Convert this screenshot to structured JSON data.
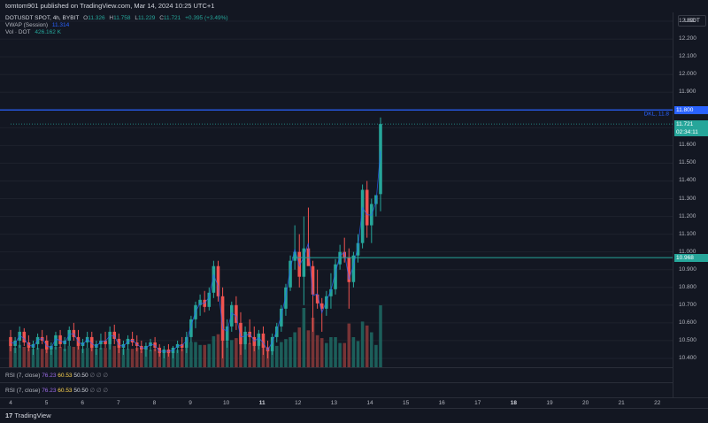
{
  "header": {
    "publisher_text": "tomtom901 published on TradingView.com, Mar 14, 2024 10:25 UTC+1"
  },
  "legend": {
    "symbol": "DOTUSDT SPOT, 4h, BYBIT",
    "open_label": "O",
    "open": "11.326",
    "high_label": "H",
    "high": "11.758",
    "low_label": "L",
    "low": "11.229",
    "close_label": "C",
    "close": "11.721",
    "change": "+0.395 (+3.49%)",
    "vwap_label": "VWAP (Session)",
    "vwap_value": "11.314",
    "vol_label": "Vol · DOT",
    "vol_value": "426.162 K"
  },
  "price_axis": {
    "currency": "USDT",
    "ticks": [
      "12.300",
      "12.200",
      "12.100",
      "12.000",
      "11.900",
      "11.800",
      "11.700",
      "11.600",
      "11.500",
      "11.400",
      "11.300",
      "11.200",
      "11.100",
      "11.000",
      "10.900",
      "10.800",
      "10.700",
      "10.600",
      "10.500",
      "10.400"
    ],
    "level_label": "11.800",
    "price_label": "11.721",
    "countdown": "02:34:11",
    "support_label": "10.968"
  },
  "chart": {
    "level_line_text": "DKL, 11.8"
  },
  "rsi_panes": [
    {
      "name": "RSI (7, close)",
      "v1": "76.23",
      "v2": "60.53",
      "v3": "50.50",
      "extra": "∅ ∅ ∅"
    },
    {
      "name": "RSI (7, close)",
      "v1": "76.23",
      "v2": "60.53",
      "v3": "50.50",
      "extra": "∅ ∅ ∅"
    }
  ],
  "time_axis": {
    "labels": [
      "4",
      "5",
      "6",
      "7",
      "8",
      "9",
      "10",
      "11",
      "12",
      "13",
      "14",
      "15",
      "16",
      "17",
      "18",
      "19",
      "20",
      "21",
      "22"
    ]
  },
  "footer": {
    "brand": "TradingView",
    "logo_mark": "17"
  },
  "colors": {
    "bg": "#131722",
    "up": "#26a69a",
    "down": "#ef5350",
    "level_line": "#2962ff",
    "support_line": "#26a69a",
    "vwap": "#2962ff",
    "vol_up": "#1f6b64",
    "vol_down": "#8a3a3a"
  },
  "chart_data": {
    "type": "candlestick",
    "symbol": "DOTUSDT SPOT",
    "interval": "4h",
    "ylim": [
      10.35,
      12.35
    ],
    "candles": [
      {
        "o": 10.52,
        "h": 10.56,
        "l": 10.44,
        "c": 10.47
      },
      {
        "o": 10.47,
        "h": 10.52,
        "l": 10.43,
        "c": 10.5
      },
      {
        "o": 10.5,
        "h": 10.58,
        "l": 10.46,
        "c": 10.55
      },
      {
        "o": 10.55,
        "h": 10.57,
        "l": 10.47,
        "c": 10.49
      },
      {
        "o": 10.49,
        "h": 10.53,
        "l": 10.44,
        "c": 10.46
      },
      {
        "o": 10.46,
        "h": 10.5,
        "l": 10.42,
        "c": 10.48
      },
      {
        "o": 10.48,
        "h": 10.54,
        "l": 10.45,
        "c": 10.52
      },
      {
        "o": 10.52,
        "h": 10.56,
        "l": 10.48,
        "c": 10.5
      },
      {
        "o": 10.5,
        "h": 10.53,
        "l": 10.43,
        "c": 10.45
      },
      {
        "o": 10.45,
        "h": 10.49,
        "l": 10.42,
        "c": 10.47
      },
      {
        "o": 10.47,
        "h": 10.55,
        "l": 10.45,
        "c": 10.53
      },
      {
        "o": 10.53,
        "h": 10.56,
        "l": 10.46,
        "c": 10.48
      },
      {
        "o": 10.48,
        "h": 10.52,
        "l": 10.44,
        "c": 10.5
      },
      {
        "o": 10.5,
        "h": 10.58,
        "l": 10.47,
        "c": 10.56
      },
      {
        "o": 10.56,
        "h": 10.6,
        "l": 10.5,
        "c": 10.52
      },
      {
        "o": 10.52,
        "h": 10.56,
        "l": 10.45,
        "c": 10.47
      },
      {
        "o": 10.47,
        "h": 10.51,
        "l": 10.43,
        "c": 10.49
      },
      {
        "o": 10.49,
        "h": 10.55,
        "l": 10.46,
        "c": 10.52
      },
      {
        "o": 10.52,
        "h": 10.55,
        "l": 10.44,
        "c": 10.46
      },
      {
        "o": 10.46,
        "h": 10.5,
        "l": 10.42,
        "c": 10.48
      },
      {
        "o": 10.48,
        "h": 10.54,
        "l": 10.45,
        "c": 10.5
      },
      {
        "o": 10.5,
        "h": 10.55,
        "l": 10.46,
        "c": 10.48
      },
      {
        "o": 10.48,
        "h": 10.58,
        "l": 10.45,
        "c": 10.55
      },
      {
        "o": 10.55,
        "h": 10.59,
        "l": 10.48,
        "c": 10.51
      },
      {
        "o": 10.51,
        "h": 10.54,
        "l": 10.43,
        "c": 10.46
      },
      {
        "o": 10.46,
        "h": 10.5,
        "l": 10.42,
        "c": 10.48
      },
      {
        "o": 10.48,
        "h": 10.53,
        "l": 10.45,
        "c": 10.51
      },
      {
        "o": 10.51,
        "h": 10.55,
        "l": 10.47,
        "c": 10.49
      },
      {
        "o": 10.49,
        "h": 10.53,
        "l": 10.44,
        "c": 10.47
      },
      {
        "o": 10.47,
        "h": 10.5,
        "l": 10.43,
        "c": 10.45
      },
      {
        "o": 10.45,
        "h": 10.49,
        "l": 10.41,
        "c": 10.47
      },
      {
        "o": 10.47,
        "h": 10.51,
        "l": 10.44,
        "c": 10.49
      },
      {
        "o": 10.49,
        "h": 10.52,
        "l": 10.44,
        "c": 10.46
      },
      {
        "o": 10.46,
        "h": 10.48,
        "l": 10.41,
        "c": 10.43
      },
      {
        "o": 10.43,
        "h": 10.47,
        "l": 10.4,
        "c": 10.45
      },
      {
        "o": 10.45,
        "h": 10.48,
        "l": 10.41,
        "c": 10.43
      },
      {
        "o": 10.43,
        "h": 10.47,
        "l": 10.4,
        "c": 10.46
      },
      {
        "o": 10.46,
        "h": 10.5,
        "l": 10.43,
        "c": 10.48
      },
      {
        "o": 10.48,
        "h": 10.52,
        "l": 10.44,
        "c": 10.46
      },
      {
        "o": 10.46,
        "h": 10.55,
        "l": 10.43,
        "c": 10.52
      },
      {
        "o": 10.52,
        "h": 10.64,
        "l": 10.49,
        "c": 10.62
      },
      {
        "o": 10.62,
        "h": 10.72,
        "l": 10.57,
        "c": 10.7
      },
      {
        "o": 10.7,
        "h": 10.76,
        "l": 10.64,
        "c": 10.73
      },
      {
        "o": 10.73,
        "h": 10.78,
        "l": 10.66,
        "c": 10.69
      },
      {
        "o": 10.69,
        "h": 10.8,
        "l": 10.67,
        "c": 10.77
      },
      {
        "o": 10.77,
        "h": 10.95,
        "l": 10.74,
        "c": 10.92
      },
      {
        "o": 10.92,
        "h": 10.95,
        "l": 10.72,
        "c": 10.75
      },
      {
        "o": 10.75,
        "h": 10.8,
        "l": 10.4,
        "c": 10.5
      },
      {
        "o": 10.5,
        "h": 10.62,
        "l": 10.46,
        "c": 10.58
      },
      {
        "o": 10.58,
        "h": 10.72,
        "l": 10.55,
        "c": 10.7
      },
      {
        "o": 10.7,
        "h": 10.75,
        "l": 10.56,
        "c": 10.6
      },
      {
        "o": 10.6,
        "h": 10.66,
        "l": 10.42,
        "c": 10.48
      },
      {
        "o": 10.48,
        "h": 10.58,
        "l": 10.45,
        "c": 10.55
      },
      {
        "o": 10.55,
        "h": 10.62,
        "l": 10.48,
        "c": 10.52
      },
      {
        "o": 10.52,
        "h": 10.58,
        "l": 10.44,
        "c": 10.47
      },
      {
        "o": 10.47,
        "h": 10.56,
        "l": 10.45,
        "c": 10.54
      },
      {
        "o": 10.54,
        "h": 10.58,
        "l": 10.42,
        "c": 10.46
      },
      {
        "o": 10.46,
        "h": 10.5,
        "l": 10.4,
        "c": 10.44
      },
      {
        "o": 10.44,
        "h": 10.54,
        "l": 10.42,
        "c": 10.52
      },
      {
        "o": 10.52,
        "h": 10.6,
        "l": 10.49,
        "c": 10.58
      },
      {
        "o": 10.58,
        "h": 10.7,
        "l": 10.55,
        "c": 10.68
      },
      {
        "o": 10.68,
        "h": 10.82,
        "l": 10.64,
        "c": 10.8
      },
      {
        "o": 10.8,
        "h": 10.98,
        "l": 10.78,
        "c": 10.95
      },
      {
        "o": 10.95,
        "h": 11.15,
        "l": 10.9,
        "c": 11.0
      },
      {
        "o": 11.0,
        "h": 11.1,
        "l": 10.8,
        "c": 10.86
      },
      {
        "o": 10.86,
        "h": 11.2,
        "l": 10.7,
        "c": 11.02
      },
      {
        "o": 11.02,
        "h": 11.25,
        "l": 10.98,
        "c": 10.92
      },
      {
        "o": 10.92,
        "h": 10.95,
        "l": 10.55,
        "c": 10.76
      },
      {
        "o": 10.76,
        "h": 10.9,
        "l": 10.68,
        "c": 10.71
      },
      {
        "o": 10.71,
        "h": 10.74,
        "l": 10.55,
        "c": 10.68
      },
      {
        "o": 10.68,
        "h": 10.78,
        "l": 10.64,
        "c": 10.75
      },
      {
        "o": 10.75,
        "h": 10.88,
        "l": 10.68,
        "c": 10.79
      },
      {
        "o": 10.79,
        "h": 10.96,
        "l": 10.76,
        "c": 10.93
      },
      {
        "o": 10.93,
        "h": 11.04,
        "l": 10.9,
        "c": 11.0
      },
      {
        "o": 11.0,
        "h": 11.08,
        "l": 10.94,
        "c": 10.97
      },
      {
        "o": 10.97,
        "h": 11.02,
        "l": 10.68,
        "c": 10.83
      },
      {
        "o": 10.83,
        "h": 11.0,
        "l": 10.8,
        "c": 10.98
      },
      {
        "o": 10.98,
        "h": 11.1,
        "l": 10.94,
        "c": 11.05
      },
      {
        "o": 11.05,
        "h": 11.38,
        "l": 11.02,
        "c": 11.35
      },
      {
        "o": 11.35,
        "h": 11.4,
        "l": 11.08,
        "c": 11.15
      },
      {
        "o": 11.15,
        "h": 11.3,
        "l": 11.05,
        "c": 11.27
      },
      {
        "o": 11.27,
        "h": 11.32,
        "l": 11.2,
        "c": 11.32
      },
      {
        "o": 11.326,
        "h": 11.758,
        "l": 11.229,
        "c": 11.721
      }
    ],
    "horizontal_levels": [
      {
        "price": 11.8,
        "label": "DKL, 11.8"
      },
      {
        "price": 10.968
      }
    ]
  }
}
